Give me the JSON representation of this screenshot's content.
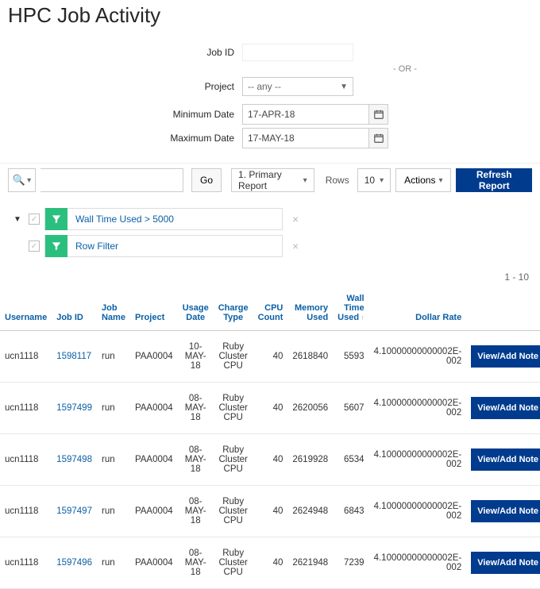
{
  "title": "HPC Job Activity",
  "form": {
    "jobid_label": "Job ID",
    "or_text": "- OR -",
    "project_label": "Project",
    "project_value": "-- any --",
    "min_date_label": "Minimum Date",
    "min_date_value": "17-APR-18",
    "max_date_label": "Maximum Date",
    "max_date_value": "17-MAY-18"
  },
  "toolbar": {
    "go": "Go",
    "report_select": "1. Primary Report",
    "rows_label": "Rows",
    "rows_value": "10",
    "actions": "Actions",
    "refresh": "Refresh Report"
  },
  "filters": [
    {
      "text": "Wall Time Used > 5000"
    },
    {
      "text": "Row Filter"
    }
  ],
  "row_count": "1 - 10",
  "columns": {
    "username": "Username",
    "jobid": "Job ID",
    "jobname": "Job Name",
    "project": "Project",
    "usage_date": "Usage Date",
    "charge_type": "Charge Type",
    "cpu_count": "CPU Count",
    "memory_used": "Memory Used",
    "wall_time_used": "Wall Time Used",
    "dollar_rate": "Dollar Rate",
    "action": ""
  },
  "action_label": "View/Add Note",
  "rows": [
    {
      "username": "ucn1118",
      "jobid": "1598117",
      "jobname": "run",
      "project": "PAA0004",
      "usage_date": "10-MAY-18",
      "charge_type": "Ruby Cluster CPU",
      "cpu_count": "40",
      "memory_used": "2618840",
      "wall_time_used": "5593",
      "dollar_rate": "4.10000000000002E-002"
    },
    {
      "username": "ucn1118",
      "jobid": "1597499",
      "jobname": "run",
      "project": "PAA0004",
      "usage_date": "08-MAY-18",
      "charge_type": "Ruby Cluster CPU",
      "cpu_count": "40",
      "memory_used": "2620056",
      "wall_time_used": "5607",
      "dollar_rate": "4.10000000000002E-002"
    },
    {
      "username": "ucn1118",
      "jobid": "1597498",
      "jobname": "run",
      "project": "PAA0004",
      "usage_date": "08-MAY-18",
      "charge_type": "Ruby Cluster CPU",
      "cpu_count": "40",
      "memory_used": "2619928",
      "wall_time_used": "6534",
      "dollar_rate": "4.10000000000002E-002"
    },
    {
      "username": "ucn1118",
      "jobid": "1597497",
      "jobname": "run",
      "project": "PAA0004",
      "usage_date": "08-MAY-18",
      "charge_type": "Ruby Cluster CPU",
      "cpu_count": "40",
      "memory_used": "2624948",
      "wall_time_used": "6843",
      "dollar_rate": "4.10000000000002E-002"
    },
    {
      "username": "ucn1118",
      "jobid": "1597496",
      "jobname": "run",
      "project": "PAA0004",
      "usage_date": "08-MAY-18",
      "charge_type": "Ruby Cluster CPU",
      "cpu_count": "40",
      "memory_used": "2621948",
      "wall_time_used": "7239",
      "dollar_rate": "4.10000000000002E-002"
    }
  ]
}
